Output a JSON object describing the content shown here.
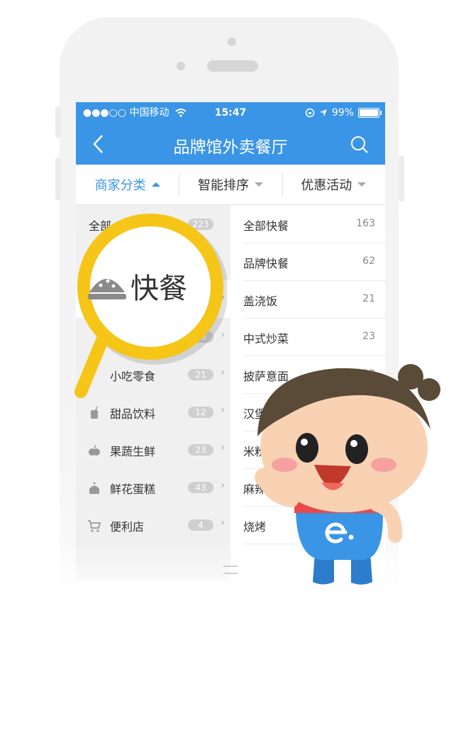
{
  "status": {
    "carrier": "●●●○○ 中国移动",
    "time": "15:47",
    "battery": "99%",
    "battery_level": 0.99
  },
  "nav": {
    "title": "品牌馆外卖餐厅"
  },
  "filters": [
    {
      "label": "商家分类",
      "active": true
    },
    {
      "label": "智能排序",
      "active": false
    },
    {
      "label": "优惠活动",
      "active": false
    }
  ],
  "left_categories": [
    {
      "label": "全部",
      "count": "223",
      "icon": "all-icon"
    },
    {
      "label": "",
      "count": "2",
      "icon": "fastfood-icon"
    },
    {
      "label": "",
      "count": "",
      "icon": "bowl-icon"
    },
    {
      "label": "",
      "count": "78",
      "icon": "dish-icon"
    },
    {
      "label": "小吃零食",
      "count": "21",
      "icon": "snack-icon"
    },
    {
      "label": "甜品饮料",
      "count": "12",
      "icon": "drink-icon"
    },
    {
      "label": "果蔬生鲜",
      "count": "23",
      "icon": "fruit-icon"
    },
    {
      "label": "鲜花蛋糕",
      "count": "43",
      "icon": "cake-icon"
    },
    {
      "label": "便利店",
      "count": "4",
      "icon": "cart-icon"
    }
  ],
  "right_categories": [
    {
      "label": "全部快餐",
      "count": "163"
    },
    {
      "label": "品牌快餐",
      "count": "62"
    },
    {
      "label": "盖浇饭",
      "count": "21"
    },
    {
      "label": "中式炒菜",
      "count": "23"
    },
    {
      "label": "披萨意面",
      "count": "12"
    },
    {
      "label": "汉堡",
      "count": ""
    },
    {
      "label": "米粉面馆",
      "count": ""
    },
    {
      "label": "麻辣烫",
      "count": ""
    },
    {
      "label": "烧烤",
      "count": ""
    }
  ],
  "magnifier": {
    "label": "快餐",
    "icon": "burger-icon"
  },
  "colors": {
    "primary": "#3a95e6",
    "magnifier": "#f5c518"
  }
}
